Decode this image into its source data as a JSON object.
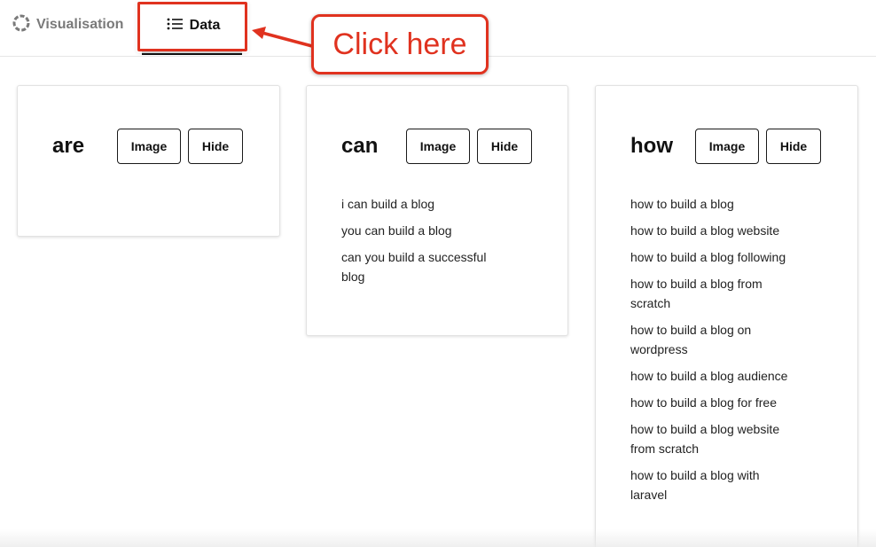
{
  "tabs": {
    "visualisation_label": "Visualisation",
    "data_label": "Data"
  },
  "annotation": {
    "callout_text": "Click here",
    "accent_color": "#e0321f"
  },
  "cards": [
    {
      "title": "are",
      "image_label": "Image",
      "hide_label": "Hide",
      "items": []
    },
    {
      "title": "can",
      "image_label": "Image",
      "hide_label": "Hide",
      "items": [
        "i can build a blog",
        "you can build a blog",
        "can you build a successful blog"
      ]
    },
    {
      "title": "how",
      "image_label": "Image",
      "hide_label": "Hide",
      "items": [
        "how to build a blog",
        "how to build a blog website",
        "how to build a blog following",
        "how to build a blog from scratch",
        "how to build a blog on wordpress",
        "how to build a blog audience",
        "how to build a blog for free",
        "how to build a blog website from scratch",
        "how to build a blog with laravel"
      ]
    }
  ]
}
